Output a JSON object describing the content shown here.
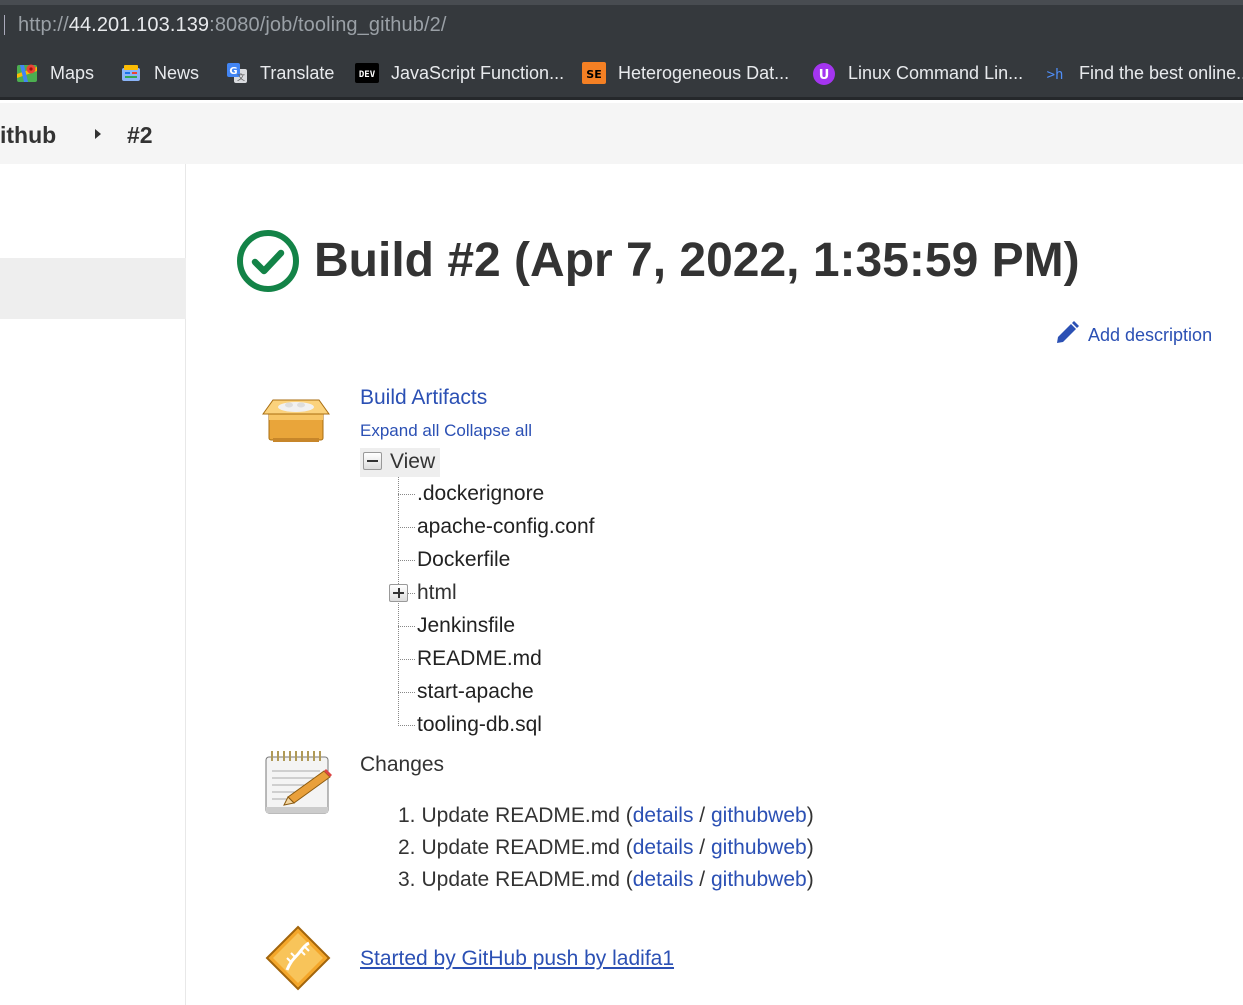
{
  "browser": {
    "url_prefix": "http://",
    "url_host": "44.201.103.139",
    "url_path": ":8080/job/tooling_github/2/",
    "bookmarks": [
      {
        "label": "Maps",
        "icon": "maps-icon"
      },
      {
        "label": "News",
        "icon": "news-icon"
      },
      {
        "label": "Translate",
        "icon": "translate-icon"
      },
      {
        "label": "JavaScript Function...",
        "icon": "dev-icon",
        "badge": "DEV"
      },
      {
        "label": "Heterogeneous Dat...",
        "icon": "se-icon",
        "badge": "SE"
      },
      {
        "label": "Linux Command Lin...",
        "icon": "u-icon",
        "badge": "U"
      },
      {
        "label": "Find the best online...",
        "icon": "terminal-icon",
        "badge": ">h"
      }
    ]
  },
  "breadcrumb": {
    "job": "ithub",
    "build": "#2"
  },
  "build": {
    "title": "Build #2 (Apr 7, 2022, 1:35:59 PM)",
    "status": "success",
    "status_color": "#138347",
    "add_description": "Add description"
  },
  "artifacts": {
    "title": "Build Artifacts",
    "expand_all": "Expand all",
    "collapse_all": "Collapse all",
    "root": "View",
    "files": [
      ".dockerignore",
      "apache-config.conf",
      "Dockerfile",
      "html",
      "Jenkinsfile",
      "README.md",
      "start-apache",
      "tooling-db.sql"
    ]
  },
  "changes": {
    "title": "Changes",
    "items": [
      {
        "num": "1.",
        "text": "Update README.md (",
        "details": "details",
        "slash": " / ",
        "githubweb": "githubweb",
        "close": ")"
      },
      {
        "num": "2.",
        "text": "Update README.md (",
        "details": "details",
        "slash": " / ",
        "githubweb": "githubweb",
        "close": ")"
      },
      {
        "num": "3.",
        "text": "Update README.md (",
        "details": "details",
        "slash": " / ",
        "githubweb": "githubweb",
        "close": ")"
      }
    ]
  },
  "cause": {
    "text": "Started by GitHub push by ladifa1"
  },
  "colors": {
    "link": "#2b50b4",
    "success": "#138347",
    "chrome": "#35393d"
  }
}
